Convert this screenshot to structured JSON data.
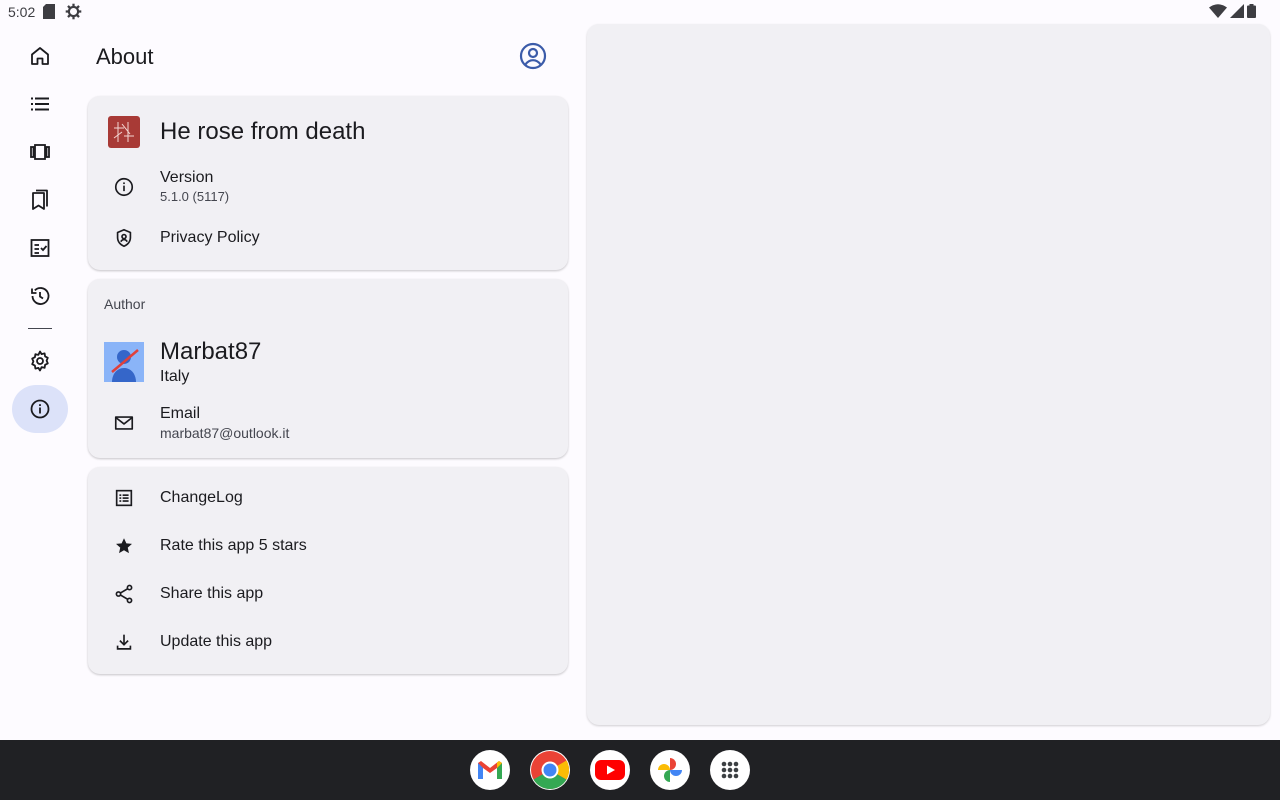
{
  "status_bar": {
    "time": "5:02",
    "left_icons": [
      "sd-card-icon",
      "settings-gear-icon"
    ],
    "right_icons": [
      "wifi-icon",
      "cell-signal-icon",
      "battery-icon"
    ]
  },
  "nav_rail": {
    "items": [
      {
        "id": "home",
        "icon": "home-icon"
      },
      {
        "id": "list",
        "icon": "list-icon"
      },
      {
        "id": "carousel",
        "icon": "carousel-icon"
      },
      {
        "id": "bookmarks",
        "icon": "bookmarks-icon"
      },
      {
        "id": "tasks",
        "icon": "checklist-icon"
      },
      {
        "id": "history",
        "icon": "history-icon"
      },
      {
        "id": "settings",
        "icon": "gear-icon"
      },
      {
        "id": "about",
        "icon": "info-icon",
        "active": true
      }
    ]
  },
  "header": {
    "title": "About",
    "account_icon": "account-circle-icon"
  },
  "app_card": {
    "app_name": "He rose from death",
    "version_label": "Version",
    "version_value": "5.1.0 (5117)",
    "privacy_label": "Privacy Policy"
  },
  "author_card": {
    "section_label": "Author",
    "name": "Marbat87",
    "country": "Italy",
    "email_label": "Email",
    "email_value": "marbat87@outlook.it"
  },
  "actions_card": {
    "items": [
      {
        "label": "ChangeLog",
        "icon": "changelog-icon"
      },
      {
        "label": "Rate this app 5 stars",
        "icon": "star-icon"
      },
      {
        "label": "Share this app",
        "icon": "share-icon"
      },
      {
        "label": "Update this app",
        "icon": "download-icon"
      }
    ]
  },
  "taskbar": {
    "apps": [
      "gmail-icon",
      "chrome-icon",
      "youtube-icon",
      "photos-icon",
      "app-drawer-icon"
    ]
  },
  "colors": {
    "background": "#fdfbff",
    "card": "#f1f0f4",
    "nav_active": "#dce2f9",
    "accent": "#3b5ba9",
    "taskbar": "#202124",
    "app_logo": "#a83a36"
  }
}
